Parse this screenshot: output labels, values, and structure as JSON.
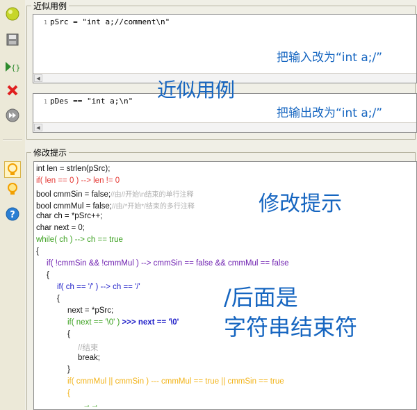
{
  "toolbar": {
    "buttons": [
      {
        "name": "run-icon",
        "color": "#c7d62a"
      },
      {
        "name": "save-icon",
        "color": "#7a7a7a"
      },
      {
        "name": "debug-icon",
        "color": "#2e8b2e"
      },
      {
        "name": "delete-icon",
        "color": "#e02020"
      },
      {
        "name": "forward-icon",
        "color": "#7a7a7a"
      },
      {
        "name": "hint-icon",
        "color": "#f2a000"
      },
      {
        "name": "bulb-icon",
        "color": "#f2a000"
      },
      {
        "name": "help-icon",
        "color": "#2a7fd4"
      }
    ]
  },
  "example_group": {
    "title": "近似用例",
    "src_line_no": "1",
    "src_code": "pSrc = \"int a;//comment\\n\"",
    "src_annotation": "把输入改为“int a;/”",
    "des_line_no": "1",
    "des_code": "pDes == \"int a;\\n\"",
    "des_annotation": "把输出改为“int a;/”",
    "overlay_label": "近似用例"
  },
  "hint_group": {
    "title": "修改提示",
    "overlay_label": "修改提示",
    "overlay_note_1": "/后面是",
    "overlay_note_2": "字符串结束符"
  },
  "code": {
    "l1": "int len = strlen(pSrc);",
    "l2": "if( len == 0 ) --> len != 0",
    "l3a": "bool cmmSin = false;",
    "l3b": "//由//开始\\n结束的单行注释",
    "l4a": "bool cmmMul = false;",
    "l4b": "//由/*开始*/结束的多行注释",
    "l5": "char ch = *pSrc++;",
    "l6": "char next = 0;",
    "l7": "while( ch ) --> ch == true",
    "l8": "{",
    "l9": "if( !cmmSin && !cmmMul ) --> cmmSin == false && cmmMul == false",
    "l10": "{",
    "l11": "if( ch == '/' ) --> ch == '/'",
    "l12": "{",
    "l13": "next = *pSrc;",
    "l14a": "if( next == '\\0' ) ",
    "l14b": ">>> next == '\\0'",
    "l15": "{",
    "l16": "//结束",
    "l17": "break;",
    "l18": "}",
    "l19": "if( cmmMul || cmmSin ) --- cmmMul == true || cmmSin == true",
    "l20": "{",
    "l21": "→→"
  }
}
